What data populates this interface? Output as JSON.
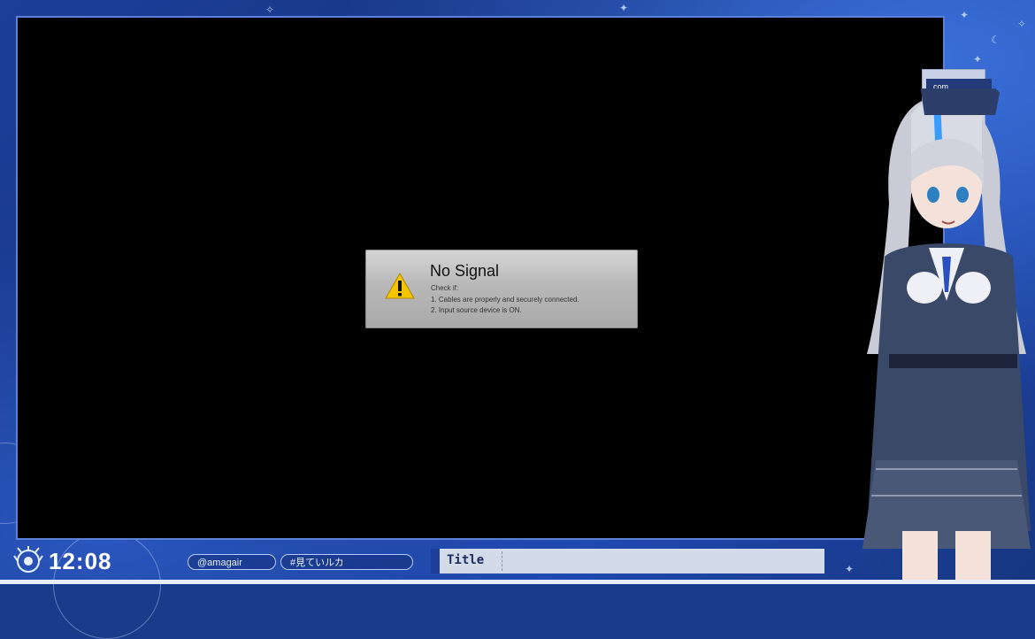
{
  "dialog": {
    "title": "No Signal",
    "lines": [
      "Check if:",
      "1. Cables are properly and securely connected.",
      "2. Input source device is ON."
    ],
    "icon": "warning-icon"
  },
  "side_panel": {
    "tab_label": "com"
  },
  "bottom": {
    "clock": "12:08",
    "handle": "@amagair",
    "hashtag": "#見ていルカ",
    "title_label": "Title"
  },
  "colors": {
    "frame_blue": "#1d3f9a",
    "accent_light": "#b7cbff",
    "dialog_gray": "#b8b8b8"
  }
}
